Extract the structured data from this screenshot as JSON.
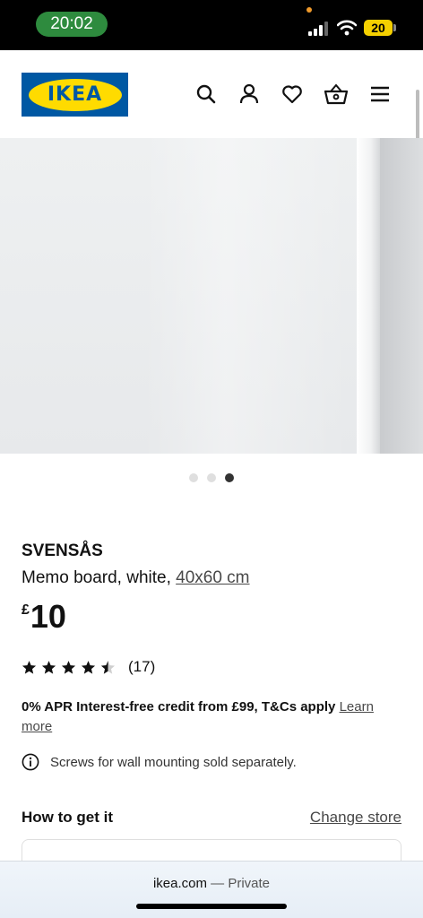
{
  "status_bar": {
    "time": "20:02",
    "battery": "20",
    "icons": [
      "signal-icon",
      "wifi-icon",
      "battery-icon"
    ]
  },
  "header": {
    "logo_text": "IKEA",
    "icons": [
      "search-icon",
      "account-icon",
      "favourites-heart-icon",
      "basket-icon",
      "menu-icon"
    ],
    "colors": {
      "brand_blue": "#0058a3",
      "brand_yellow": "#ffdb00"
    }
  },
  "gallery": {
    "image_count": 3,
    "active_index": 3
  },
  "product": {
    "name": "SVENSÅS",
    "description": "Memo board, white, ",
    "size_link": "40x60 cm",
    "price_currency": "£",
    "price_amount": "10",
    "rating_value": 4.5,
    "rating_count": "(17)"
  },
  "credit": {
    "text": "0% APR Interest-free credit from £99, T&Cs apply",
    "link": "Learn more"
  },
  "notice": {
    "text": "Screws for wall mounting sold separately."
  },
  "delivery": {
    "title": "How to get it",
    "change_store": "Change store"
  },
  "browser": {
    "domain": "ikea.com",
    "separator": " — ",
    "mode": "Private"
  }
}
